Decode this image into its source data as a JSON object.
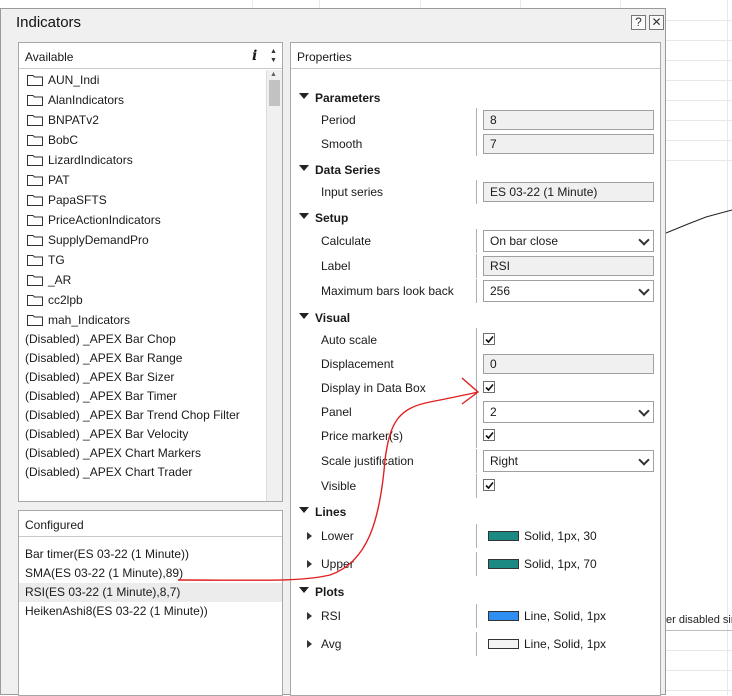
{
  "window": {
    "title": "Indicators",
    "help_label": "?",
    "close_label": "✕"
  },
  "available": {
    "header": "Available",
    "info_label": "i",
    "folders": [
      "AUN_Indi",
      "AlanIndicators",
      "BNPATv2",
      "BobC",
      "LizardIndicators",
      "PAT",
      "PapaSFTS",
      "PriceActionIndicators",
      "SupplyDemandPro",
      "TG",
      "_AR",
      "cc2lpb",
      "mah_Indicators"
    ],
    "items": [
      "(Disabled) _APEX Bar Chop",
      "(Disabled) _APEX Bar Range",
      "(Disabled) _APEX Bar Sizer",
      "(Disabled) _APEX Bar Timer",
      "(Disabled) _APEX Bar Trend Chop Filter",
      "(Disabled) _APEX Bar Velocity",
      "(Disabled) _APEX Chart Markers",
      "(Disabled) _APEX Chart Trader"
    ]
  },
  "configured": {
    "header": "Configured",
    "items": [
      "Bar timer(ES 03-22 (1 Minute))",
      "SMA(ES 03-22 (1 Minute),89)",
      "RSI(ES 03-22 (1 Minute),8,7)",
      "HeikenAshi8(ES 03-22 (1 Minute))"
    ]
  },
  "properties": {
    "header": "Properties",
    "parameters": {
      "label": "Parameters",
      "period_label": "Period",
      "period": "8",
      "smooth_label": "Smooth",
      "smooth": "7"
    },
    "data_series": {
      "label": "Data Series",
      "input_label": "Input series",
      "input": "ES 03-22 (1 Minute)"
    },
    "setup": {
      "label": "Setup",
      "calculate_label": "Calculate",
      "calculate": "On bar close",
      "label_label": "Label",
      "label_value": "RSI",
      "max_bars_label": "Maximum bars look back",
      "max_bars": "256"
    },
    "visual": {
      "label": "Visual",
      "auto_scale_label": "Auto scale",
      "auto_scale": true,
      "displacement_label": "Displacement",
      "displacement": "0",
      "data_box_label": "Display in Data Box",
      "data_box": true,
      "panel_label": "Panel",
      "panel": "2",
      "price_marker_label": "Price marker(s)",
      "price_marker": true,
      "scale_label": "Scale justification",
      "scale": "Right",
      "visible_label": "Visible",
      "visible": true
    },
    "lines": {
      "label": "Lines",
      "lower_label": "Lower",
      "lower": "Solid, 1px, 30",
      "lower_color": "#1b8a82",
      "upper_label": "Upper",
      "upper": "Solid, 1px, 70",
      "upper_color": "#1b8a82"
    },
    "plots": {
      "label": "Plots",
      "rsi_label": "RSI",
      "rsi": "Line, Solid, 1px",
      "rsi_color": "#2f8ef2",
      "avg_label": "Avg",
      "avg": "Line, Solid, 1px",
      "avg_color": "#f4f4f4"
    }
  },
  "background": {
    "chart_text": "er disabled sir"
  },
  "annotation_color": "#e02020"
}
